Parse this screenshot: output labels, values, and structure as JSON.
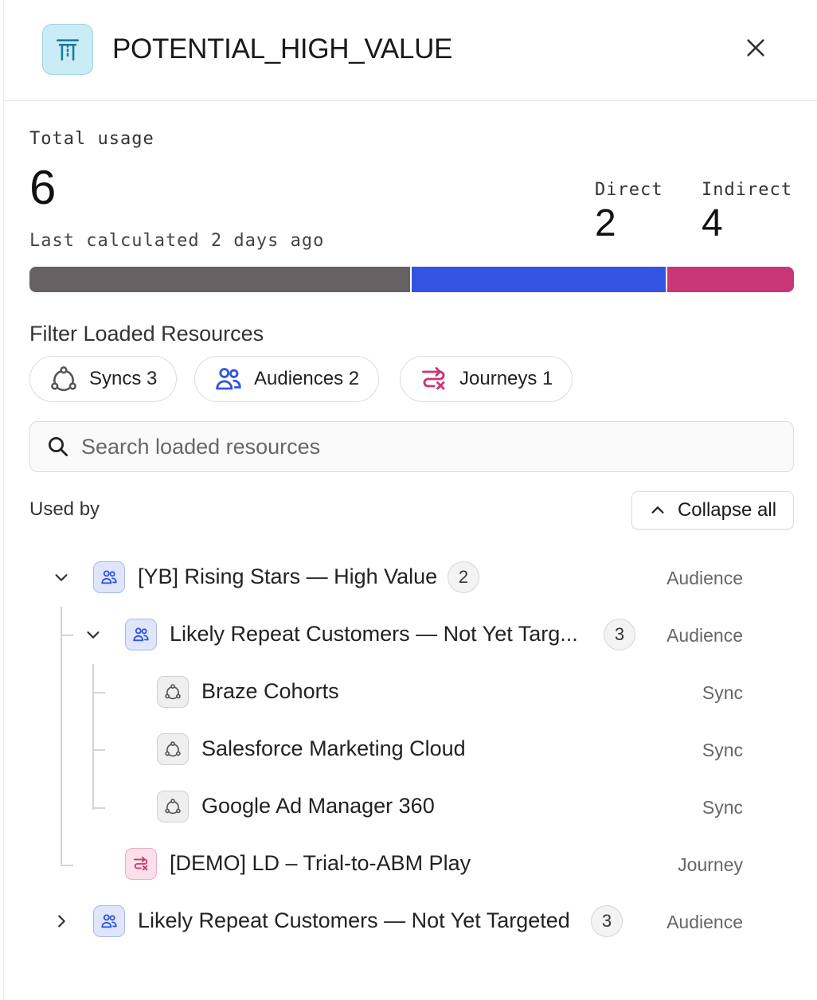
{
  "header": {
    "title": "POTENTIAL_HIGH_VALUE",
    "model_icon": "torii-gate-icon",
    "close_icon": "close-icon"
  },
  "usage": {
    "label": "Total usage",
    "total": "6",
    "last_calculated": "Last calculated 2 days ago",
    "direct_label": "Direct",
    "direct_value": "2",
    "indirect_label": "Indirect",
    "indirect_value": "4",
    "breakdown": [
      {
        "name": "Syncs",
        "value": 3,
        "color": "#666263"
      },
      {
        "name": "Audiences",
        "value": 2,
        "color": "#3254e0"
      },
      {
        "name": "Journeys",
        "value": 1,
        "color": "#c93676"
      }
    ]
  },
  "filters": {
    "title": "Filter Loaded Resources",
    "chips": [
      {
        "label": "Syncs 3",
        "icon": "sync-icon",
        "color": "#555555"
      },
      {
        "label": "Audiences 2",
        "icon": "audience-icon",
        "color": "#3254e0"
      },
      {
        "label": "Journeys 1",
        "icon": "journey-icon",
        "color": "#c93676"
      }
    ]
  },
  "search": {
    "placeholder": "Search loaded resources",
    "value": ""
  },
  "used_by": {
    "label": "Used by",
    "collapse_label": "Collapse all"
  },
  "tree": [
    {
      "name": "[YB] Rising Stars — High Value",
      "count": "2",
      "type": "Audience",
      "kind": "aud",
      "expanded": true
    },
    {
      "name": "Likely Repeat Customers — Not Yet Targ...",
      "count": "3",
      "type": "Audience",
      "kind": "aud",
      "expanded": true
    },
    {
      "name": "Braze Cohorts",
      "type": "Sync",
      "kind": "sync"
    },
    {
      "name": "Salesforce Marketing Cloud",
      "type": "Sync",
      "kind": "sync"
    },
    {
      "name": "Google Ad Manager 360",
      "type": "Sync",
      "kind": "sync"
    },
    {
      "name": "[DEMO] LD – Trial-to-ABM Play",
      "type": "Journey",
      "kind": "jour"
    },
    {
      "name": "Likely Repeat Customers — Not Yet Targeted",
      "count": "3",
      "type": "Audience",
      "kind": "aud",
      "expanded": false
    }
  ],
  "colors": {
    "audience": "#3254e0",
    "sync": "#555555",
    "journey": "#c93676"
  }
}
